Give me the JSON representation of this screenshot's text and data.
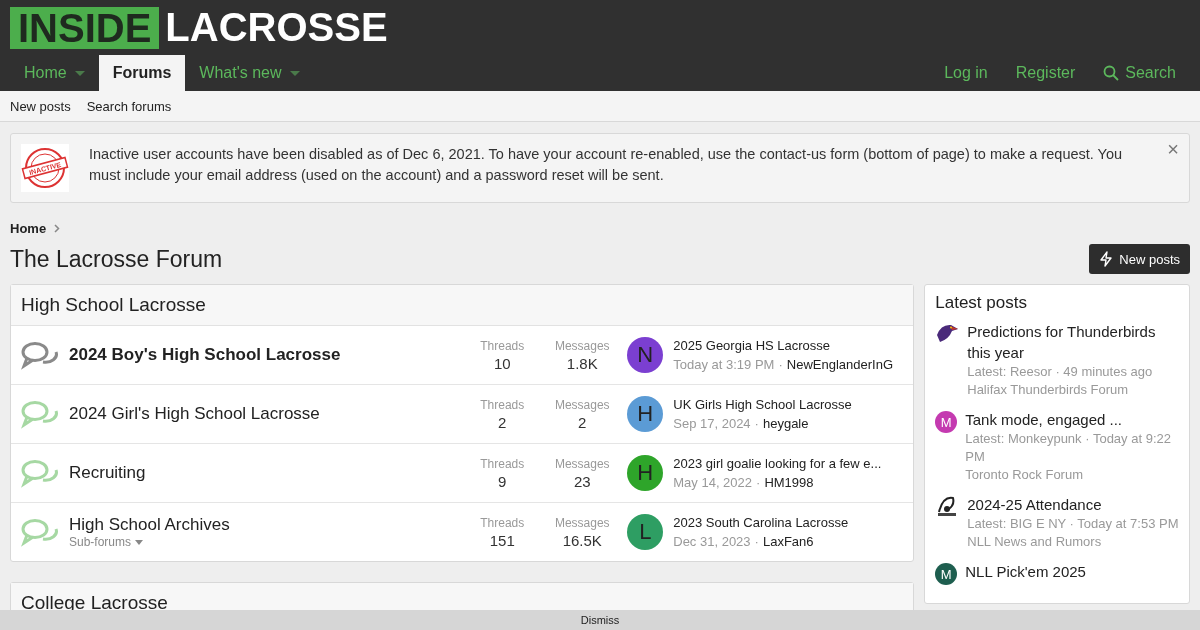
{
  "logo": {
    "left": "INSIDE",
    "right": "LACROSSE"
  },
  "nav": {
    "tabs": [
      {
        "label": "Home",
        "selected": false,
        "has_menu": true
      },
      {
        "label": "Forums",
        "selected": true,
        "has_menu": false
      },
      {
        "label": "What's new",
        "selected": false,
        "has_menu": true
      }
    ],
    "right": [
      "Log in",
      "Register"
    ],
    "search": "Search"
  },
  "subnav": [
    "New posts",
    "Search forums"
  ],
  "notice": {
    "badge": "INACTIVE",
    "text": "Inactive user accounts have been disabled as of Dec 6, 2021. To have your account re-enabled, use the contact-us form (bottom of page) to make a request. You must include your email address (used on the account) and a password reset will be sent.",
    "close": "×"
  },
  "breadcrumb": [
    "Home"
  ],
  "title": "The Lacrosse Forum",
  "new_posts_button": "New posts",
  "categories": [
    {
      "title": "High School Lacrosse",
      "forums": [
        {
          "name": "2024 Boy's High School Lacrosse",
          "unread": true,
          "threads_label": "Threads",
          "threads": "10",
          "messages_label": "Messages",
          "messages": "1.8K",
          "avatar": "N",
          "color": "#7b3fd1",
          "last_title": "2025 Georgia HS Lacrosse",
          "last_date": "Today at 3:19 PM",
          "separator": "·",
          "last_user": "NewEnglanderInG"
        },
        {
          "name": "2024 Girl's High School Lacrosse",
          "unread": false,
          "threads_label": "Threads",
          "threads": "2",
          "messages_label": "Messages",
          "messages": "2",
          "avatar": "H",
          "color": "#5b9bd5",
          "last_title": "UK Girls High School Lacrosse",
          "last_date": "Sep 17, 2024",
          "separator": "·",
          "last_user": "heygale"
        },
        {
          "name": "Recruiting",
          "unread": false,
          "threads_label": "Threads",
          "threads": "9",
          "messages_label": "Messages",
          "messages": "23",
          "avatar": "H",
          "color": "#2ea52a",
          "last_title": "2023 girl goalie looking for a few e...",
          "last_date": "May 14, 2022",
          "separator": "·",
          "last_user": "HM1998"
        },
        {
          "name": "High School Archives",
          "unread": false,
          "subforums": "Sub-forums",
          "threads_label": "Threads",
          "threads": "151",
          "messages_label": "Messages",
          "messages": "16.5K",
          "avatar": "L",
          "color": "#2e9e63",
          "last_title": "2023 South Carolina Lacrosse",
          "last_date": "Dec 31, 2023",
          "separator": "·",
          "last_user": "LaxFan6"
        }
      ]
    },
    {
      "title": "College Lacrosse"
    }
  ],
  "sidebar": {
    "title": "Latest posts",
    "items": [
      {
        "title": "Predictions for Thunderbirds this year",
        "meta": "Latest: Reesor · 49 minutes ago",
        "forum": "Halifax Thunderbirds Forum"
      },
      {
        "kind": "letter",
        "avatar": "M",
        "color": "#c43ab0",
        "title": "Tank mode, engaged ...",
        "meta": "Latest: Monkeypunk · Today at 9:22 PM",
        "forum": "Toronto Rock Forum"
      },
      {
        "title": "2024-25 Attendance",
        "meta": "Latest: BIG E NY · Today at 7:53 PM",
        "forum": "NLL News and Rumors"
      },
      {
        "kind": "letter",
        "avatar": "M",
        "color": "#1e5e4f",
        "title": "NLL Pick'em 2025"
      }
    ]
  },
  "cookie_bar": {
    "button": "Dismiss"
  }
}
